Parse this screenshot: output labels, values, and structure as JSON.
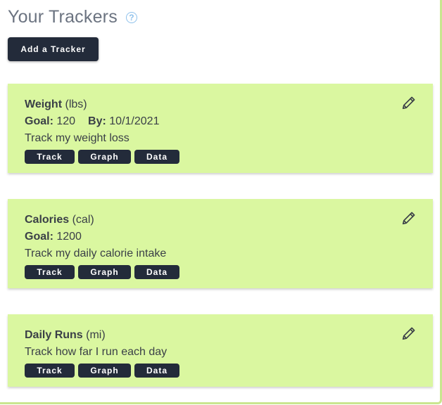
{
  "header": {
    "title": "Your Trackers",
    "help_icon": "?"
  },
  "add_button_label": "Add a Tracker",
  "trackers": [
    {
      "name": "Weight",
      "unit": "(lbs)",
      "goal_label": "Goal:",
      "goal": "120",
      "by_label": "By:",
      "by": "10/1/2021",
      "description": "Track my weight loss"
    },
    {
      "name": "Calories",
      "unit": "(cal)",
      "goal_label": "Goal:",
      "goal": "1200",
      "description": "Track my daily calorie intake"
    },
    {
      "name": "Daily Runs",
      "unit": "(mi)",
      "description": "Track how far I run each day"
    }
  ],
  "actions": {
    "track": "Track",
    "graph": "Graph",
    "data": "Data"
  },
  "colors": {
    "card_bg": "#daf7a0",
    "button_bg": "#232b3a",
    "help_icon": "#8ec1ec"
  }
}
